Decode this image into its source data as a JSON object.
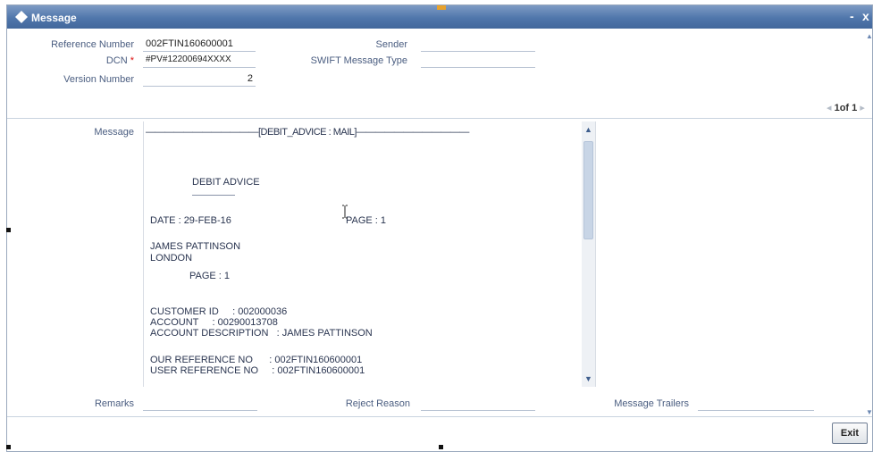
{
  "window": {
    "title": "Message",
    "minimize_label": "-",
    "close_label": "x"
  },
  "header": {
    "reference_number": {
      "label": "Reference Number",
      "value": "002FTIN160600001"
    },
    "dcn": {
      "label": "DCN",
      "required_mark": "*",
      "value": "#PV#12200694XXXX"
    },
    "version_number": {
      "label": "Version Number",
      "value": "2"
    },
    "sender": {
      "label": "Sender",
      "value": ""
    },
    "swift_message_type": {
      "label": "SWIFT Message Type",
      "value": ""
    }
  },
  "pager": {
    "prev": "◂",
    "text": "1of 1",
    "next": "▸"
  },
  "message": {
    "label": "Message",
    "lines": [
      "————————————[DEBIT_ADVICE : MAIL]————————————",
      "DEBIT ADVICE",
      "DATE : 29-FEB-16",
      "PAGE : 1",
      "JAMES PATTINSON",
      "LONDON",
      "PAGE : 1",
      "CUSTOMER ID     : 002000036",
      "ACCOUNT     : 00290013708",
      "ACCOUNT DESCRIPTION   : JAMES PATTINSON",
      "OUR REFERENCE NO      : 002FTIN160600001",
      "USER REFERENCE NO     : 002FTIN160600001"
    ]
  },
  "footer": {
    "remarks": {
      "label": "Remarks",
      "value": ""
    },
    "reject_reason": {
      "label": "Reject Reason",
      "value": ""
    },
    "message_trailers": {
      "label": "Message Trailers",
      "value": ""
    }
  },
  "buttons": {
    "exit": "Exit"
  },
  "colors": {
    "titlebar": "#4f76ab",
    "label": "#4a5d80",
    "required": "#dd1111",
    "accent": "#e8a22c"
  }
}
